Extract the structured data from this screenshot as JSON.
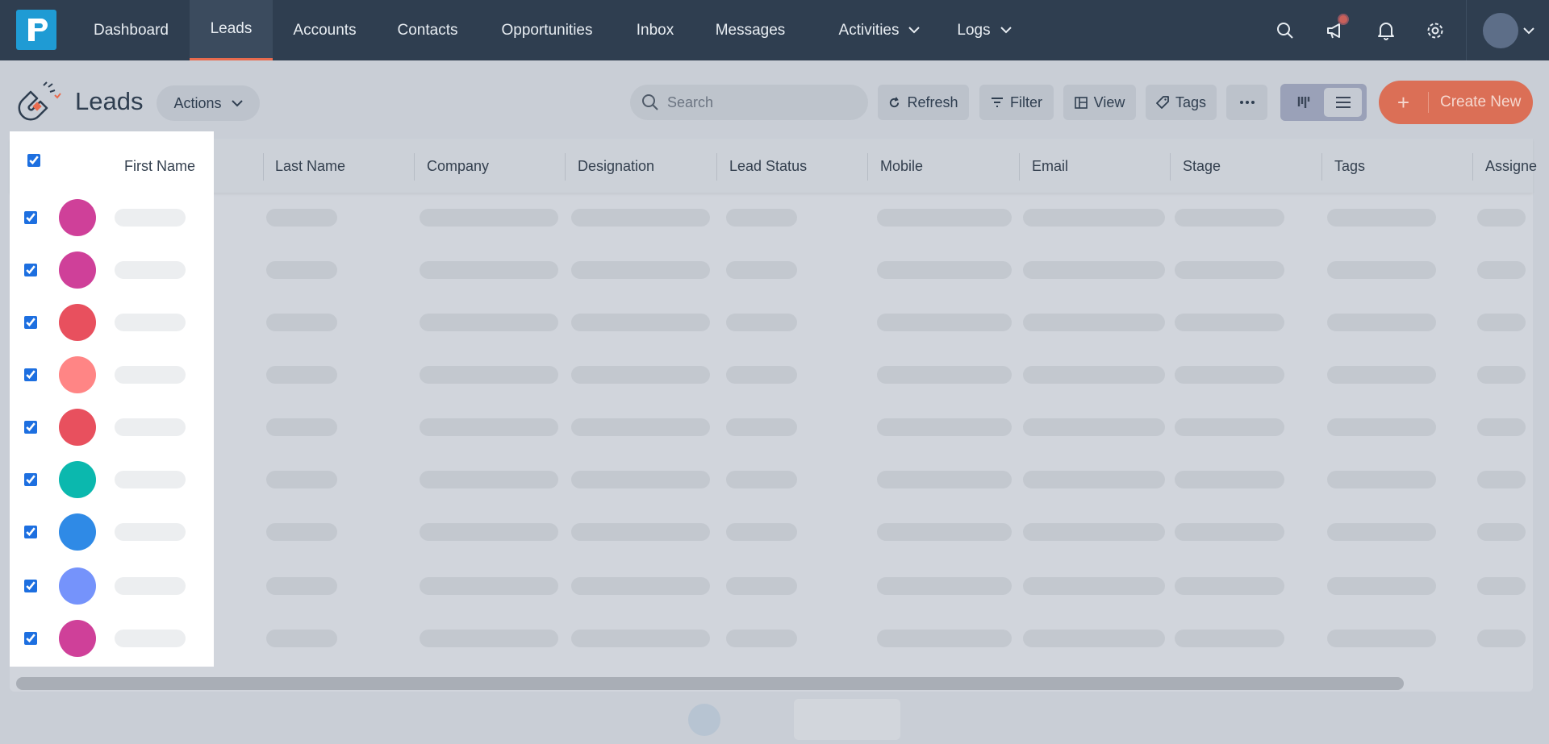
{
  "nav": {
    "items": [
      {
        "label": "Dashboard"
      },
      {
        "label": "Leads"
      },
      {
        "label": "Accounts"
      },
      {
        "label": "Contacts"
      },
      {
        "label": "Opportunities"
      },
      {
        "label": "Inbox"
      },
      {
        "label": "Messages"
      },
      {
        "label": "Activities"
      },
      {
        "label": "Logs"
      }
    ],
    "active": "Leads",
    "icons": [
      "search-icon",
      "megaphone-icon",
      "bell-icon",
      "gear-icon",
      "avatar",
      "chevron-down-icon"
    ]
  },
  "header": {
    "title": "Leads",
    "actions_label": "Actions",
    "search_placeholder": "Search",
    "refresh_label": "Refresh",
    "filter_label": "Filter",
    "view_label": "View",
    "tags_label": "Tags",
    "create_label": "Create New"
  },
  "table": {
    "columns": [
      {
        "label": "First Name"
      },
      {
        "label": "Last Name"
      },
      {
        "label": "Company"
      },
      {
        "label": "Designation"
      },
      {
        "label": "Lead Status"
      },
      {
        "label": "Mobile"
      },
      {
        "label": "Email"
      },
      {
        "label": "Stage"
      },
      {
        "label": "Tags"
      },
      {
        "label": "Assigne"
      }
    ],
    "rows_avatar_colors": [
      "#cf4099",
      "#cf4099",
      "#e8505e",
      "#ff8585",
      "#e8505e",
      "#0bb8ae",
      "#2f8ae6",
      "#7593fb",
      "#cf4099"
    ],
    "all_selected": true
  },
  "colors": {
    "nav_bg": "#2f3e50",
    "accent": "#e96b4e",
    "create_button": "#db6f56",
    "logo": "#1f9bd4"
  }
}
